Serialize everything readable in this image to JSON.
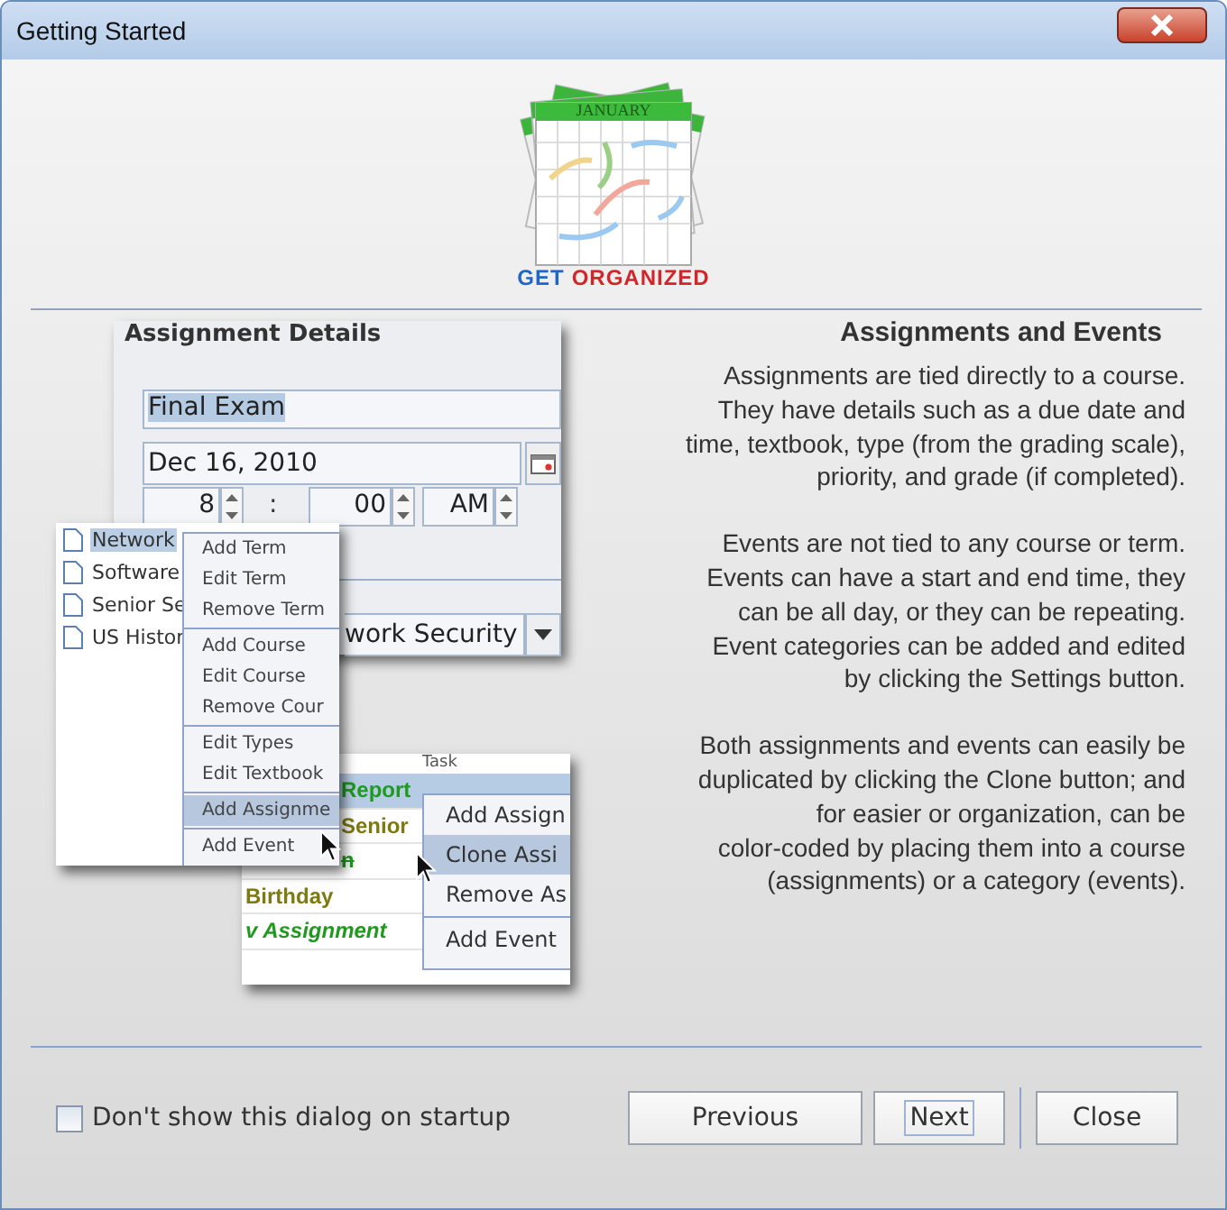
{
  "window": {
    "title": "Getting Started"
  },
  "logo": {
    "month": "JANUARY",
    "words": [
      {
        "text": "GET",
        "color": "#1f66c8"
      },
      {
        "text": "ORGANIZED",
        "color": "#d3262a"
      }
    ]
  },
  "illustration": {
    "details": {
      "heading": "Assignment Details",
      "title_value": "Final Exam",
      "date_value": "Dec 16, 2010",
      "hour": "8",
      "colon": ":",
      "minute": "00",
      "meridiem": "AM",
      "course_value": "work Security"
    },
    "tree": [
      {
        "label": "Network",
        "selected": true
      },
      {
        "label": "Software",
        "selected": false
      },
      {
        "label": "Senior Se",
        "selected": false
      },
      {
        "label": "US Histor",
        "selected": false
      }
    ],
    "tree_menu": [
      [
        {
          "label": "Add Term",
          "selected": false
        },
        {
          "label": "Edit Term",
          "selected": false
        },
        {
          "label": "Remove Term",
          "selected": false
        }
      ],
      [
        {
          "label": "Add Course",
          "selected": false
        },
        {
          "label": "Edit Course",
          "selected": false
        },
        {
          "label": "Remove Cour",
          "selected": false
        }
      ],
      [
        {
          "label": "Edit Types",
          "selected": false
        },
        {
          "label": "Edit Textbook",
          "selected": false
        }
      ],
      [
        {
          "label": "Add Assignme",
          "selected": true
        }
      ],
      [
        {
          "label": "Add Event",
          "selected": false
        }
      ]
    ],
    "task_header": "Task",
    "tasks": [
      {
        "text": "Report",
        "color": "#1f9a1f",
        "selected": true,
        "italic": false,
        "struck": false
      },
      {
        "text": "Senior",
        "color": "#7d7a12",
        "selected": false,
        "italic": false,
        "struck": false
      },
      {
        "text": "n",
        "color": "#1f9a1f",
        "selected": false,
        "italic": false,
        "struck": true
      },
      {
        "text": "Birthday",
        "color": "#7d7a12",
        "selected": false,
        "italic": false,
        "struck": false
      },
      {
        "text": "v Assignment",
        "color": "#1f9a1f",
        "selected": false,
        "italic": true,
        "struck": false
      }
    ],
    "task_menu": [
      [
        {
          "label": "Add Assign",
          "selected": false
        },
        {
          "label": "Clone Assi",
          "selected": true
        },
        {
          "label": "Remove As",
          "selected": false
        }
      ],
      [
        {
          "label": "Add Event",
          "selected": false
        }
      ]
    ]
  },
  "info": {
    "heading": "Assignments and Events",
    "paragraphs": [
      "Assignments are tied directly to a course.\nThey have details such as a due date and\ntime, textbook, type (from the grading scale),\npriority, and grade (if completed).",
      "Events are not tied to any course or term.\nEvents can have a start and end time, they\ncan be all day, or they can be repeating.\nEvent categories can be added and edited\nby clicking the Settings button.",
      "Both assignments and events can easily be\nduplicated by clicking the Clone button; and\nfor easier or organization, can be\ncolor-coded by placing them into a course\n(assignments) or a category (events)."
    ]
  },
  "footer": {
    "checkbox": {
      "label": "Don't show this dialog on startup",
      "checked": false
    },
    "buttons": [
      {
        "label": "Previous",
        "focused": false
      },
      {
        "label": "Next",
        "focused": true
      },
      {
        "label": "Close",
        "focused": false
      }
    ]
  }
}
